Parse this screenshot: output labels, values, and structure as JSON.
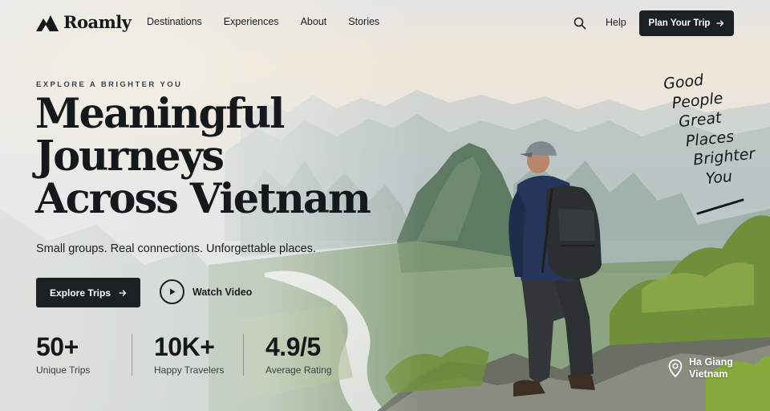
{
  "brand": {
    "name": "Roamly",
    "logo_icon": "mountain-logo-icon"
  },
  "nav": {
    "items": [
      {
        "label": "Destinations"
      },
      {
        "label": "Experiences"
      },
      {
        "label": "About"
      },
      {
        "label": "Stories"
      }
    ],
    "search_icon": "search-icon",
    "help_label": "Help",
    "cta_label": "Plan Your Trip",
    "cta_icon": "arrow-right-icon"
  },
  "hero": {
    "eyebrow": "EXPLORE A BRIGHTER YOU",
    "headline": [
      "Meaningful",
      "Journeys",
      "Across Vietnam"
    ],
    "subtitle": "Small groups. Real connections. Unforgettable places.",
    "primary_button": "Explore Trips",
    "video_button": "Watch Video",
    "video_icon": "play-icon"
  },
  "stats": [
    {
      "value": "50+",
      "label": "Unique Trips"
    },
    {
      "value": "10K+",
      "label": "Happy Travelers"
    },
    {
      "value": "4.9/5",
      "label": "Average Rating"
    }
  ],
  "tagline": [
    "Good",
    "People",
    "Great",
    "Places",
    "Brighter",
    "You"
  ],
  "location": {
    "icon": "map-pin-icon",
    "lines": [
      "Ha Giang",
      "Vietnam"
    ]
  },
  "colors": {
    "dark": "#1b2024",
    "text": "#1b1f22",
    "sky_top": "#dfe3e6",
    "sky_glow": "#f6e3c7",
    "foliage": "#6f8f3a"
  }
}
